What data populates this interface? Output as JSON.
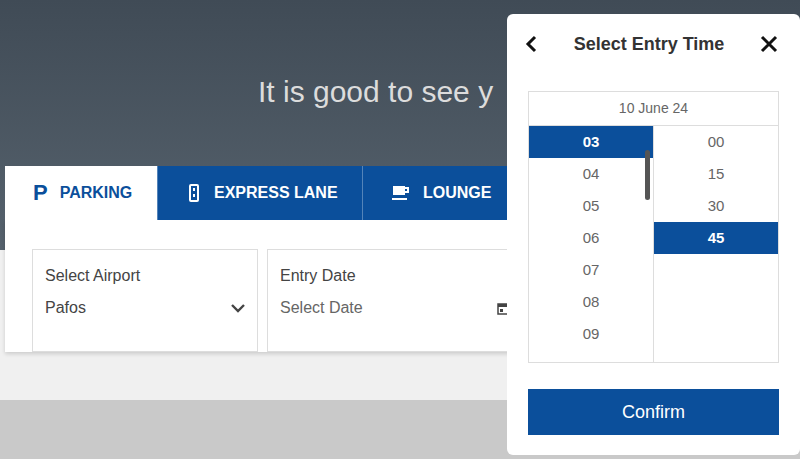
{
  "hero": {
    "subtitle": "It is good to see y"
  },
  "tabs": [
    {
      "label": "PARKING",
      "icon": "P",
      "selected": true
    },
    {
      "label": "EXPRESS LANE",
      "selected": false
    },
    {
      "label": "LOUNGE",
      "selected": false
    }
  ],
  "form": {
    "airport": {
      "label": "Select Airport",
      "value": "Pafos"
    },
    "entry_date": {
      "label": "Entry Date",
      "placeholder": "Select Date"
    }
  },
  "time_picker": {
    "title": "Select Entry Time",
    "date": "10 June 24",
    "hours": [
      {
        "label": "03",
        "selected": true
      },
      {
        "label": "04",
        "selected": false
      },
      {
        "label": "05",
        "selected": false
      },
      {
        "label": "06",
        "selected": false
      },
      {
        "label": "07",
        "selected": false
      },
      {
        "label": "08",
        "selected": false
      },
      {
        "label": "09",
        "selected": false
      }
    ],
    "minutes": [
      {
        "label": "00",
        "selected": false
      },
      {
        "label": "15",
        "selected": false
      },
      {
        "label": "30",
        "selected": false
      },
      {
        "label": "45",
        "selected": true
      }
    ],
    "confirm": "Confirm"
  }
}
